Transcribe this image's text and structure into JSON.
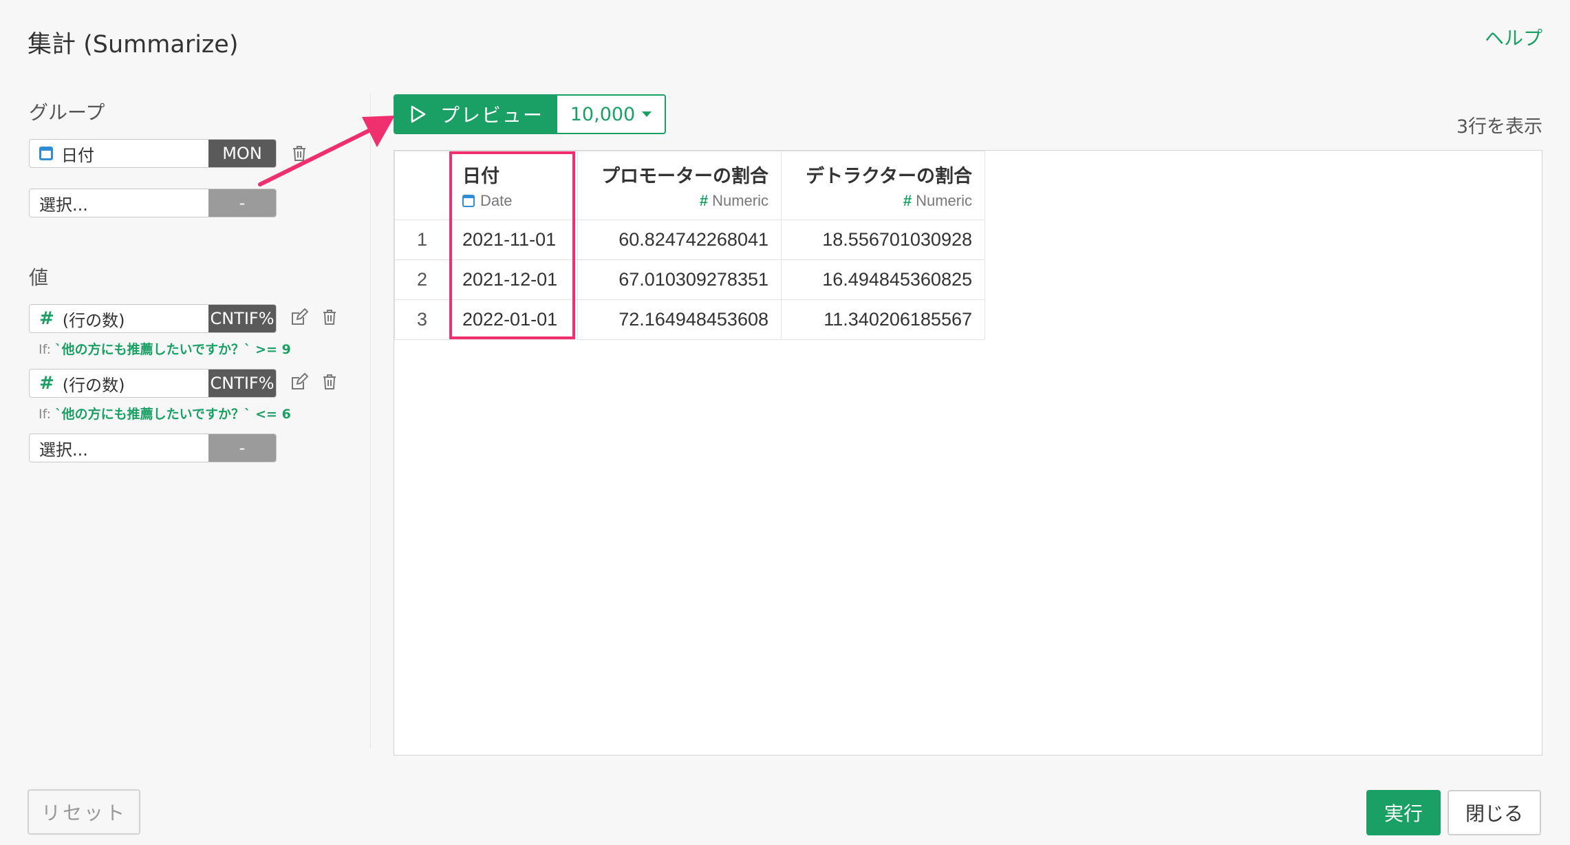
{
  "header": {
    "title": "集計 (Summarize)",
    "help_label": "ヘルプ"
  },
  "left": {
    "group_label": "グループ",
    "group_field": {
      "name": "日付",
      "func": "MON"
    },
    "group_select": {
      "placeholder": "選択...",
      "tag": "-"
    },
    "value_label": "値",
    "values": [
      {
        "name": "(行の数)",
        "func": "CNTIF%",
        "cond_prefix": "If:",
        "cond": "`他の方にも推薦したいですか？` >= 9"
      },
      {
        "name": "(行の数)",
        "func": "CNTIF%",
        "cond_prefix": "If:",
        "cond": "`他の方にも推薦したいですか？` <= 6"
      }
    ],
    "value_select": {
      "placeholder": "選択...",
      "tag": "-"
    }
  },
  "preview": {
    "label": "プレビュー",
    "count": "10,000",
    "row_count": "3行を表示"
  },
  "table": {
    "columns": [
      {
        "name": "日付",
        "type": "Date"
      },
      {
        "name": "プロモーターの割合",
        "type": "Numeric"
      },
      {
        "name": "デトラクターの割合",
        "type": "Numeric"
      }
    ],
    "rows": [
      {
        "idx": "1",
        "date": "2021-11-01",
        "promoter": "60.824742268041",
        "detractor": "18.556701030928"
      },
      {
        "idx": "2",
        "date": "2021-12-01",
        "promoter": "67.010309278351",
        "detractor": "16.494845360825"
      },
      {
        "idx": "3",
        "date": "2022-01-01",
        "promoter": "72.164948453608",
        "detractor": "11.340206185567"
      }
    ]
  },
  "footer": {
    "reset_label": "リセット",
    "run_label": "実行",
    "close_label": "閉じる"
  },
  "colors": {
    "accent": "#1aa065",
    "highlight": "#f0306e",
    "tag_dark": "#5a5a5a"
  }
}
